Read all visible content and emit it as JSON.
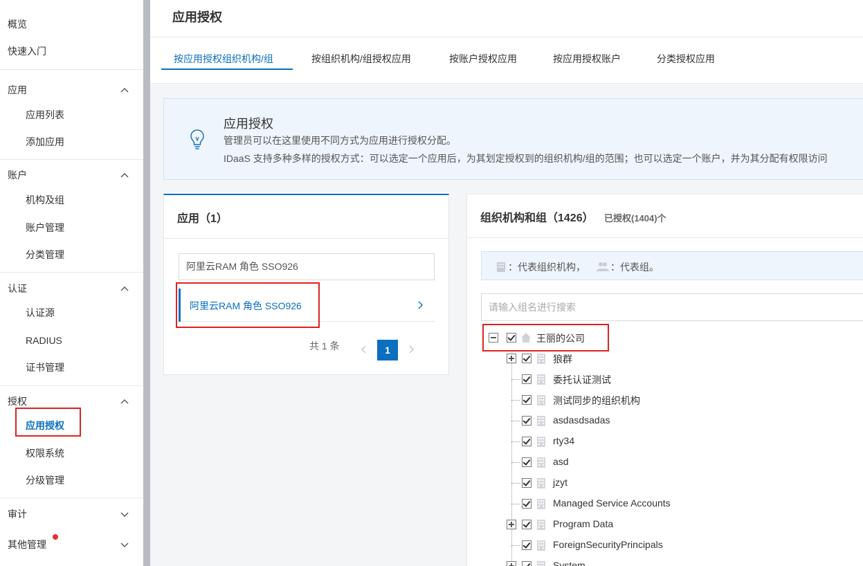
{
  "sidebar": {
    "overview": "概览",
    "quickstart": "快速入门",
    "groups": [
      {
        "label": "应用",
        "items": [
          "应用列表",
          "添加应用"
        ]
      },
      {
        "label": "账户",
        "items": [
          "机构及组",
          "账户管理",
          "分类管理"
        ]
      },
      {
        "label": "认证",
        "items": [
          "认证源",
          "RADIUS",
          "证书管理"
        ]
      },
      {
        "label": "授权",
        "items": [
          "应用授权",
          "权限系统",
          "分级管理"
        ]
      }
    ],
    "audit": "审计",
    "other": "其他管理"
  },
  "header": {
    "title": "应用授权"
  },
  "tabs": [
    "按应用授权组织机构/组",
    "按组织机构/组授权应用",
    "按账户授权应用",
    "按应用授权账户",
    "分类授权应用"
  ],
  "info": {
    "title": "应用授权",
    "line1": "管理员可以在这里使用不同方式为应用进行授权分配。",
    "line2": "IDaaS 支持多种多样的授权方式：可以选定一个应用后，为其划定授权到的组织机构/组的范围；也可以选定一个账户，并为其分配有权限访问"
  },
  "app_panel": {
    "title": "应用（1）",
    "search_value": "阿里云RAM 角色 SSO926",
    "apps": [
      "阿里云RAM 角色 SSO926"
    ],
    "total": "共 1 条",
    "page": "1"
  },
  "org_panel": {
    "title": "组织机构和组（1426）",
    "subtitle": "已授权(1404)个",
    "legend_org": "：代表组织机构，",
    "legend_group": "：代表组。",
    "search_placeholder": "请输入组名进行搜索",
    "root": "王丽的公司",
    "children": [
      "狼群",
      "委托认证测试",
      "测试同步的组织机构",
      "asdasdsadas",
      "rty34",
      "asd",
      "jzyt",
      "Managed Service Accounts",
      "Program Data",
      "ForeignSecurityPrincipals",
      "System"
    ]
  },
  "colors": {
    "accent": "#0c6fbf",
    "highlight": "#e02020"
  }
}
